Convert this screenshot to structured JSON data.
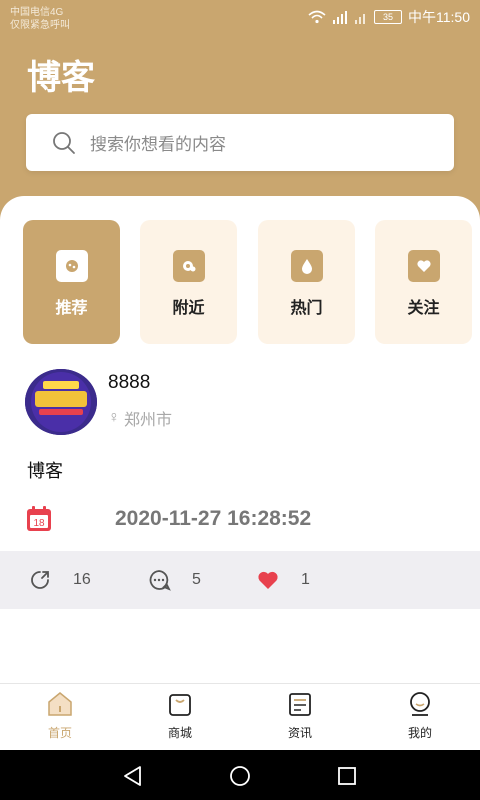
{
  "status_bar": {
    "carrier_line1": "中国电信4G",
    "carrier_line2": "仅限紧急呼叫",
    "battery": "35",
    "time": "中午11:50"
  },
  "header": {
    "title": "博客"
  },
  "search": {
    "placeholder": "搜索你想看的内容"
  },
  "categories": [
    {
      "label": "推荐",
      "icon": "recommend-icon",
      "active": true
    },
    {
      "label": "附近",
      "icon": "nearby-icon",
      "active": false
    },
    {
      "label": "热门",
      "icon": "hot-icon",
      "active": false
    },
    {
      "label": "关注",
      "icon": "follow-icon",
      "active": false
    }
  ],
  "post": {
    "username": "8888",
    "gender_symbol": "♀",
    "location": "郑州市",
    "content": "博客",
    "calendar_day": "18",
    "datetime": "2020-11-27 16:28:52",
    "stats": {
      "shares": "16",
      "comments": "5",
      "likes": "1"
    }
  },
  "bottom_nav": [
    {
      "label": "首页",
      "icon": "home-icon",
      "active": true
    },
    {
      "label": "商城",
      "icon": "shop-icon",
      "active": false
    },
    {
      "label": "资讯",
      "icon": "news-icon",
      "active": false
    },
    {
      "label": "我的",
      "icon": "profile-icon",
      "active": false
    }
  ],
  "colors": {
    "accent": "#c9a66f",
    "accent_light": "#fdf3e6",
    "like": "#e8414e",
    "calendar": "#e8414e"
  }
}
